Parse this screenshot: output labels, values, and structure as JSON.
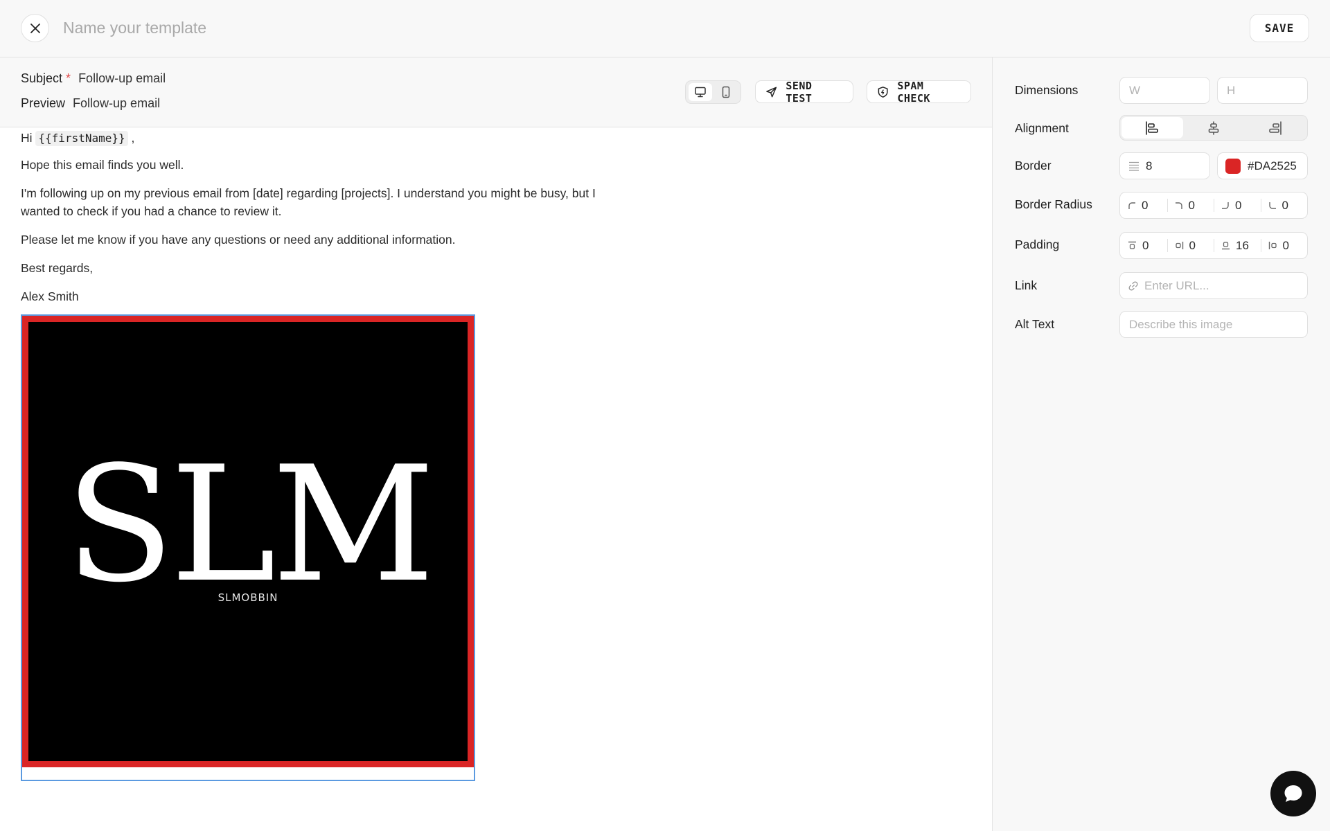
{
  "topbar": {
    "name_placeholder": "Name your template",
    "save_label": "SAVE"
  },
  "editor": {
    "subject_label": "Subject",
    "required_marker": "*",
    "subject_value": "Follow-up email",
    "preview_label": "Preview",
    "preview_value": "Follow-up email",
    "send_test_label": "SEND TEST",
    "spam_check_label": "SPAM CHECK"
  },
  "email": {
    "greeting_prefix": "Hi",
    "greeting_variable": "{{firstName}}",
    "greeting_suffix": ",",
    "paragraphs": [
      "Hope this email finds you well.",
      "I'm following up on my previous email from [date] regarding [projects]. I understand you might be busy, but I wanted to check if you had a chance to review it.",
      "Please let me know if you have any questions or need any additional information.",
      "Best regards,",
      "Alex Smith"
    ],
    "image": {
      "logo_text": "SLM",
      "logo_caption": "SLMOBBIN"
    }
  },
  "panel": {
    "dimensions_label": "Dimensions",
    "width_placeholder": "W",
    "height_placeholder": "H",
    "alignment_label": "Alignment",
    "alignment_selected": "left",
    "border_label": "Border",
    "border_width": "8",
    "border_color": "#DA2525",
    "border_radius_label": "Border Radius",
    "border_radius": [
      "0",
      "0",
      "0",
      "0"
    ],
    "padding_label": "Padding",
    "padding": [
      "0",
      "0",
      "16",
      "0"
    ],
    "link_label": "Link",
    "link_placeholder": "Enter URL...",
    "alt_label": "Alt Text",
    "alt_placeholder": "Describe this image"
  },
  "colors": {
    "accent_border": "#DA2525",
    "selection": "#5b9ae0",
    "required": "#e04848"
  }
}
